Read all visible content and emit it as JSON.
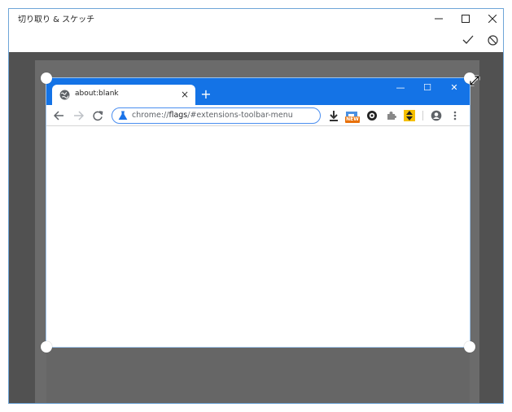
{
  "app": {
    "title": "切り取り & スケッチ",
    "controls": [
      "minimize-icon",
      "maximize-icon",
      "close-icon"
    ]
  },
  "action_bar": {
    "icons": [
      "checkmark-icon",
      "cancel-icon"
    ]
  },
  "snip": {
    "tab": {
      "title": "about:blank",
      "close": "×"
    },
    "new_tab": "+",
    "window_controls": {
      "minimize": "—",
      "maximize": "☐",
      "close": "✕"
    },
    "omnibox": {
      "scheme": "chrome://",
      "host": "flags",
      "path": "/#extensions-toolbar-menu"
    },
    "extensions": [
      {
        "name": "download-icon"
      },
      {
        "name": "new-extension-icon",
        "badge": "NEW"
      },
      {
        "name": "extension-circle-icon"
      },
      {
        "name": "extension-puzzle-icon"
      },
      {
        "name": "extension-arrows-icon"
      },
      {
        "name": "profile-icon"
      },
      {
        "name": "menu-icon"
      }
    ],
    "colors": {
      "chrome_blue": "#1473e6",
      "omnibox_border": "#4a8ef0",
      "badge": "#e8710a"
    }
  },
  "colors": {
    "canvas": "#515151",
    "window_border": "#6fa6d8"
  }
}
